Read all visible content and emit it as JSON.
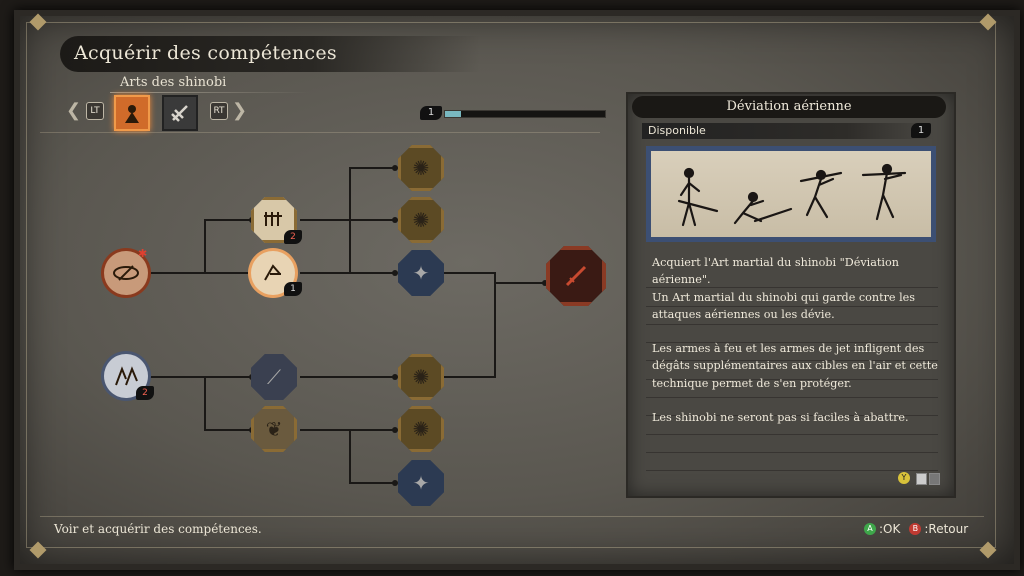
{
  "header": {
    "title": "Acquérir des compétences",
    "category": "Arts des shinobi"
  },
  "tabs": {
    "left_trigger": "LT",
    "right_trigger": "RT",
    "left_arrow": "❮",
    "right_arrow": "❯",
    "items": [
      {
        "icon": "shinobi-arts-icon",
        "active": true
      },
      {
        "icon": "prosthetic-arts-icon",
        "active": false
      }
    ]
  },
  "skill_points": {
    "value": "1",
    "progress_fraction": 0.1
  },
  "nodes": {
    "root_top_badge": "",
    "node_a_count": "2",
    "node_b_count": "1",
    "root_bottom_count": "2"
  },
  "detail": {
    "title": "Déviation aérienne",
    "status": "Disponible",
    "cost": "1",
    "lines": [
      "Acquiert l'Art martial du shinobi \"Déviation aérienne\".",
      "Un Art martial du shinobi qui garde contre les attaques aériennes ou les dévie.",
      "Les armes à feu et les armes de jet infligent des dégâts supplémentaires aux cibles en l'air et cette technique permet de s'en protéger.",
      "Les shinobi ne seront pas si faciles à abattre."
    ],
    "y_button": "Y"
  },
  "footer": {
    "hint": "Voir et acquérir des compétences.",
    "a_button": "A",
    "ok_label": ":OK",
    "b_button": "B",
    "back_label": ":Retour"
  }
}
